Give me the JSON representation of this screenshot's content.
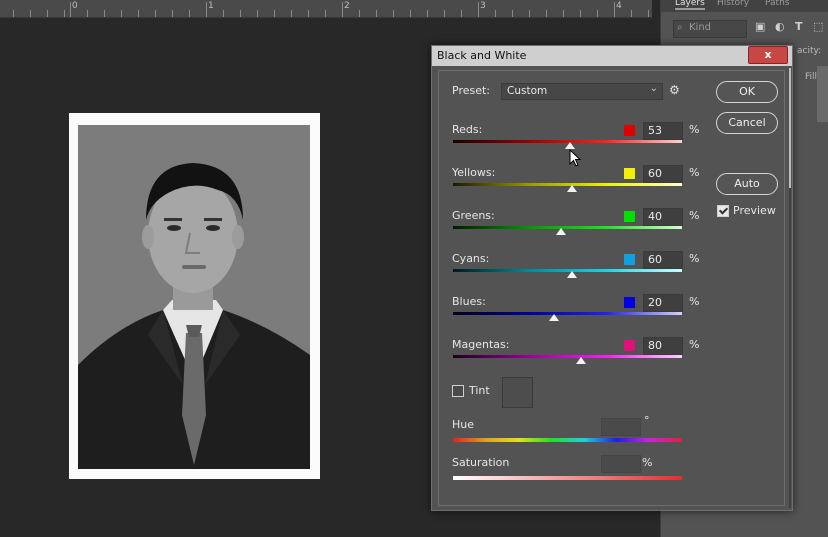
{
  "ruler": {
    "numbers": [
      "0",
      "1",
      "2",
      "3",
      "4"
    ]
  },
  "panel": {
    "tabs": [
      "Layers",
      "History",
      "Paths"
    ],
    "kind_placeholder": "Kind",
    "opacity_label": "acity:",
    "fill_label": "Fill:"
  },
  "dialog": {
    "title": "Black and White",
    "close_label": "x",
    "preset_label": "Preset:",
    "preset_value": "Custom",
    "ok_label": "OK",
    "cancel_label": "Cancel",
    "auto_label": "Auto",
    "preview_label": "Preview",
    "preview_checked": true,
    "sliders": [
      {
        "label": "Reds:",
        "value": "53",
        "unit": "%",
        "color": "#e00000",
        "thumb_position": 0.51
      },
      {
        "label": "Yellows:",
        "value": "60",
        "unit": "%",
        "color": "#f0f000",
        "thumb_position": 0.52
      },
      {
        "label": "Greens:",
        "value": "40",
        "unit": "%",
        "color": "#00e000",
        "thumb_position": 0.47
      },
      {
        "label": "Cyans:",
        "value": "60",
        "unit": "%",
        "color": "#10a0e0",
        "thumb_position": 0.52
      },
      {
        "label": "Blues:",
        "value": "20",
        "unit": "%",
        "color": "#0000e0",
        "thumb_position": 0.44
      },
      {
        "label": "Magentas:",
        "value": "80",
        "unit": "%",
        "color": "#e0107a",
        "thumb_position": 0.56
      }
    ],
    "tint_label": "Tint",
    "tint_checked": false,
    "hue_label": "Hue",
    "hue_unit": "°",
    "saturation_label": "Saturation",
    "saturation_unit": "%"
  }
}
